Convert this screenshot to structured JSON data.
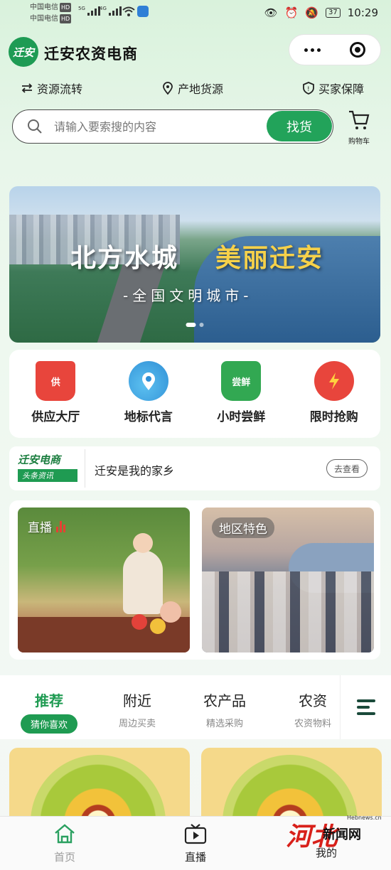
{
  "status_bar": {
    "carrier1": "中国电信",
    "carrier2": "中国电信",
    "hd": "HD",
    "net1": "5G",
    "net2": "4G",
    "battery": "37",
    "time": "10:29"
  },
  "header": {
    "logo_text": "迁安",
    "title": "迁安农资电商"
  },
  "features": [
    "资源流转",
    "产地货源",
    "买家保障"
  ],
  "search": {
    "placeholder": "请输入要索搜的内容",
    "button": "找货",
    "cart_label": "购物车"
  },
  "banner": {
    "slogan_left": "北方水城",
    "slogan_right": "美丽迁安",
    "subline": "-全国文明城市-"
  },
  "quick_menu": [
    {
      "label": "供应大厅",
      "icon": "basket-icon",
      "badge": "供",
      "color": "#e8453c"
    },
    {
      "label": "地标代言",
      "icon": "map-pin-icon",
      "badge": "",
      "color": "#2f8fd6"
    },
    {
      "label": "小时尝鲜",
      "icon": "veggie-basket-icon",
      "badge": "尝鲜",
      "color": "#32a852"
    },
    {
      "label": "限时抢购",
      "icon": "alarm-clock-icon",
      "badge": "",
      "color": "#e8453c"
    }
  ],
  "news": {
    "brand_top": "迁安电商",
    "brand_bottom": "头条资讯",
    "headline": "迁安是我的家乡",
    "more": "去查看"
  },
  "cards": {
    "live": "直播",
    "region": "地区特色"
  },
  "tabs": [
    {
      "title": "推荐",
      "sub": "猜你喜欢",
      "active": true
    },
    {
      "title": "附近",
      "sub": "周边买卖",
      "active": false
    },
    {
      "title": "农产品",
      "sub": "精选采购",
      "active": false
    },
    {
      "title": "农资",
      "sub": "农资物料",
      "active": false
    }
  ],
  "bottom_nav": [
    {
      "label": "首页",
      "icon": "home-icon"
    },
    {
      "label": "直播",
      "icon": "tv-play-icon"
    },
    {
      "label": "我的",
      "icon": "user-icon"
    }
  ],
  "watermark": {
    "logo": "河北",
    "name": "新闻网",
    "url": "Hebnews.cn"
  },
  "colors": {
    "brand_green": "#1f9b52",
    "accent_red": "#e8453c"
  }
}
